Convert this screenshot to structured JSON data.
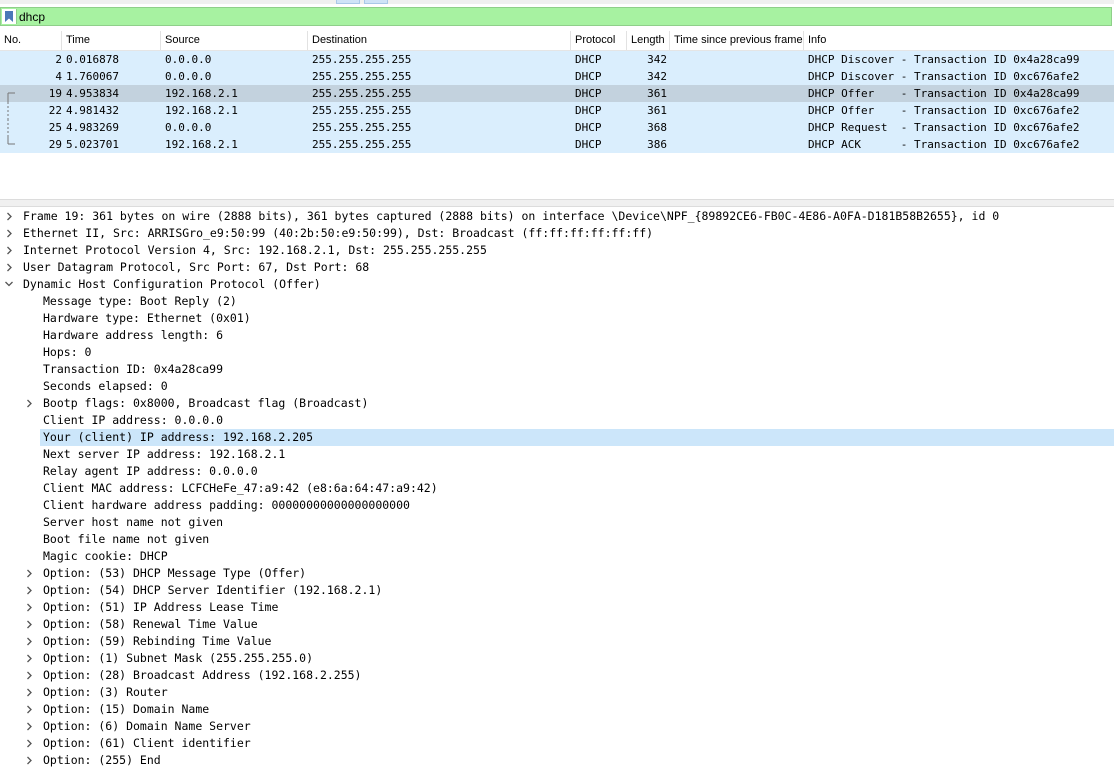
{
  "filter": {
    "value": "dhcp"
  },
  "packet_list": {
    "columns": [
      "No.",
      "Time",
      "Source",
      "Destination",
      "Protocol",
      "Length",
      "Time since previous frame",
      "Info"
    ],
    "rows": [
      {
        "no": "2",
        "time": "0.016878",
        "src": "0.0.0.0",
        "dst": "255.255.255.255",
        "proto": "DHCP",
        "len": "342",
        "tsp": "",
        "info": "DHCP Discover - Transaction ID 0x4a28ca99",
        "selected": false
      },
      {
        "no": "4",
        "time": "1.760067",
        "src": "0.0.0.0",
        "dst": "255.255.255.255",
        "proto": "DHCP",
        "len": "342",
        "tsp": "",
        "info": "DHCP Discover - Transaction ID 0xc676afe2",
        "selected": false
      },
      {
        "no": "19",
        "time": "4.953834",
        "src": "192.168.2.1",
        "dst": "255.255.255.255",
        "proto": "DHCP",
        "len": "361",
        "tsp": "",
        "info": "DHCP Offer    - Transaction ID 0x4a28ca99",
        "selected": true
      },
      {
        "no": "22",
        "time": "4.981432",
        "src": "192.168.2.1",
        "dst": "255.255.255.255",
        "proto": "DHCP",
        "len": "361",
        "tsp": "",
        "info": "DHCP Offer    - Transaction ID 0xc676afe2",
        "selected": false
      },
      {
        "no": "25",
        "time": "4.983269",
        "src": "0.0.0.0",
        "dst": "255.255.255.255",
        "proto": "DHCP",
        "len": "368",
        "tsp": "",
        "info": "DHCP Request  - Transaction ID 0xc676afe2",
        "selected": false
      },
      {
        "no": "29",
        "time": "5.023701",
        "src": "192.168.2.1",
        "dst": "255.255.255.255",
        "proto": "DHCP",
        "len": "386",
        "tsp": "",
        "info": "DHCP ACK      - Transaction ID 0xc676afe2",
        "selected": false
      }
    ]
  },
  "details": [
    {
      "level": 0,
      "arrow": "collapsed",
      "text": "Frame 19: 361 bytes on wire (2888 bits), 361 bytes captured (2888 bits) on interface \\Device\\NPF_{89892CE6-FB0C-4E86-A0FA-D181B58B2655}, id 0"
    },
    {
      "level": 0,
      "arrow": "collapsed",
      "text": "Ethernet II, Src: ARRISGro_e9:50:99 (40:2b:50:e9:50:99), Dst: Broadcast (ff:ff:ff:ff:ff:ff)"
    },
    {
      "level": 0,
      "arrow": "collapsed",
      "text": "Internet Protocol Version 4, Src: 192.168.2.1, Dst: 255.255.255.255"
    },
    {
      "level": 0,
      "arrow": "collapsed",
      "text": "User Datagram Protocol, Src Port: 67, Dst Port: 68"
    },
    {
      "level": 0,
      "arrow": "expanded",
      "text": "Dynamic Host Configuration Protocol (Offer)"
    },
    {
      "level": 1,
      "arrow": "none",
      "text": "Message type: Boot Reply (2)"
    },
    {
      "level": 1,
      "arrow": "none",
      "text": "Hardware type: Ethernet (0x01)"
    },
    {
      "level": 1,
      "arrow": "none",
      "text": "Hardware address length: 6"
    },
    {
      "level": 1,
      "arrow": "none",
      "text": "Hops: 0"
    },
    {
      "level": 1,
      "arrow": "none",
      "text": "Transaction ID: 0x4a28ca99"
    },
    {
      "level": 1,
      "arrow": "none",
      "text": "Seconds elapsed: 0"
    },
    {
      "level": 1,
      "arrow": "collapsed",
      "text": "Bootp flags: 0x8000, Broadcast flag (Broadcast)"
    },
    {
      "level": 1,
      "arrow": "none",
      "text": "Client IP address: 0.0.0.0"
    },
    {
      "level": 1,
      "arrow": "none",
      "text": "Your (client) IP address: 192.168.2.205",
      "highlight": true
    },
    {
      "level": 1,
      "arrow": "none",
      "text": "Next server IP address: 192.168.2.1"
    },
    {
      "level": 1,
      "arrow": "none",
      "text": "Relay agent IP address: 0.0.0.0"
    },
    {
      "level": 1,
      "arrow": "none",
      "text": "Client MAC address: LCFCHeFe_47:a9:42 (e8:6a:64:47:a9:42)"
    },
    {
      "level": 1,
      "arrow": "none",
      "text": "Client hardware address padding: 00000000000000000000"
    },
    {
      "level": 1,
      "arrow": "none",
      "text": "Server host name not given"
    },
    {
      "level": 1,
      "arrow": "none",
      "text": "Boot file name not given"
    },
    {
      "level": 1,
      "arrow": "none",
      "text": "Magic cookie: DHCP"
    },
    {
      "level": 1,
      "arrow": "collapsed",
      "text": "Option: (53) DHCP Message Type (Offer)"
    },
    {
      "level": 1,
      "arrow": "collapsed",
      "text": "Option: (54) DHCP Server Identifier (192.168.2.1)"
    },
    {
      "level": 1,
      "arrow": "collapsed",
      "text": "Option: (51) IP Address Lease Time"
    },
    {
      "level": 1,
      "arrow": "collapsed",
      "text": "Option: (58) Renewal Time Value"
    },
    {
      "level": 1,
      "arrow": "collapsed",
      "text": "Option: (59) Rebinding Time Value"
    },
    {
      "level": 1,
      "arrow": "collapsed",
      "text": "Option: (1) Subnet Mask (255.255.255.0)"
    },
    {
      "level": 1,
      "arrow": "collapsed",
      "text": "Option: (28) Broadcast Address (192.168.2.255)"
    },
    {
      "level": 1,
      "arrow": "collapsed",
      "text": "Option: (3) Router"
    },
    {
      "level": 1,
      "arrow": "collapsed",
      "text": "Option: (15) Domain Name"
    },
    {
      "level": 1,
      "arrow": "collapsed",
      "text": "Option: (6) Domain Name Server"
    },
    {
      "level": 1,
      "arrow": "collapsed",
      "text": "Option: (61) Client identifier"
    },
    {
      "level": 1,
      "arrow": "collapsed",
      "text": "Option: (255) End"
    }
  ],
  "colors": {
    "filter_valid": "#a7f2a1",
    "row_bg": "#daeefd",
    "row_selected": "#c3d2de",
    "detail_highlight": "#cce6fa"
  },
  "icons": {
    "filter_bookmark": "bookmark-icon",
    "tree_collapsed": "chevron-right-icon",
    "tree_expanded": "chevron-down-icon"
  }
}
